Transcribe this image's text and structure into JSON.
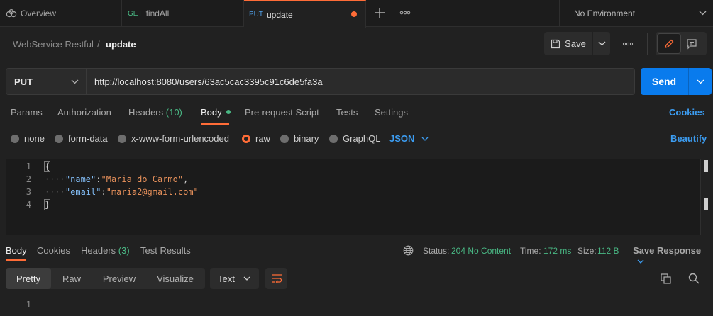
{
  "tabs": [
    {
      "icon": "collection-overview-icon",
      "label": "Overview"
    },
    {
      "method": "GET",
      "label": "findAll"
    },
    {
      "method": "PUT",
      "label": "update",
      "unsaved": true
    }
  ],
  "environment": "No Environment",
  "breadcrumb": {
    "collection": "WebService Restful",
    "separator": "/",
    "request": "update"
  },
  "toolbar": {
    "save_label": "Save"
  },
  "request": {
    "method": "PUT",
    "url": "http://localhost:8080/users/63ac5cac3395c91c6de5fa3a",
    "send_label": "Send"
  },
  "request_tabs": {
    "params": "Params",
    "authorization": "Authorization",
    "headers": "Headers",
    "headers_count": "(10)",
    "body": "Body",
    "prerequest": "Pre-request Script",
    "tests": "Tests",
    "settings": "Settings",
    "cookies": "Cookies"
  },
  "body_modes": {
    "none": "none",
    "form_data": "form-data",
    "urlencoded": "x-www-form-urlencoded",
    "raw": "raw",
    "binary": "binary",
    "graphql": "GraphQL",
    "format": "JSON",
    "beautify": "Beautify",
    "selected": "raw"
  },
  "editor": {
    "line_numbers": [
      "1",
      "2",
      "3",
      "4"
    ],
    "open_brace": "{",
    "close_brace": "}",
    "indent": "····",
    "line2_key": "\"name\"",
    "line2_value": "\"Maria do Carmo\"",
    "line3_key": "\"email\"",
    "line3_value": "\"maria2@gmail.com\""
  },
  "response": {
    "tabs": {
      "body": "Body",
      "cookies": "Cookies",
      "headers": "Headers",
      "headers_count": "(3)",
      "tests": "Test Results"
    },
    "status_label": "Status:",
    "status_value": "204 No Content",
    "time_label": "Time:",
    "time_value": "172 ms",
    "size_label": "Size:",
    "size_value": "112 B",
    "save_response": "Save Response",
    "views": {
      "pretty": "Pretty",
      "raw": "Raw",
      "preview": "Preview",
      "visualize": "Visualize"
    },
    "format": "Text",
    "line_numbers": [
      "1"
    ]
  },
  "colors": {
    "accent": "#ff6c37",
    "send": "#097bed",
    "link": "#3c9df2",
    "success": "#49b884"
  }
}
